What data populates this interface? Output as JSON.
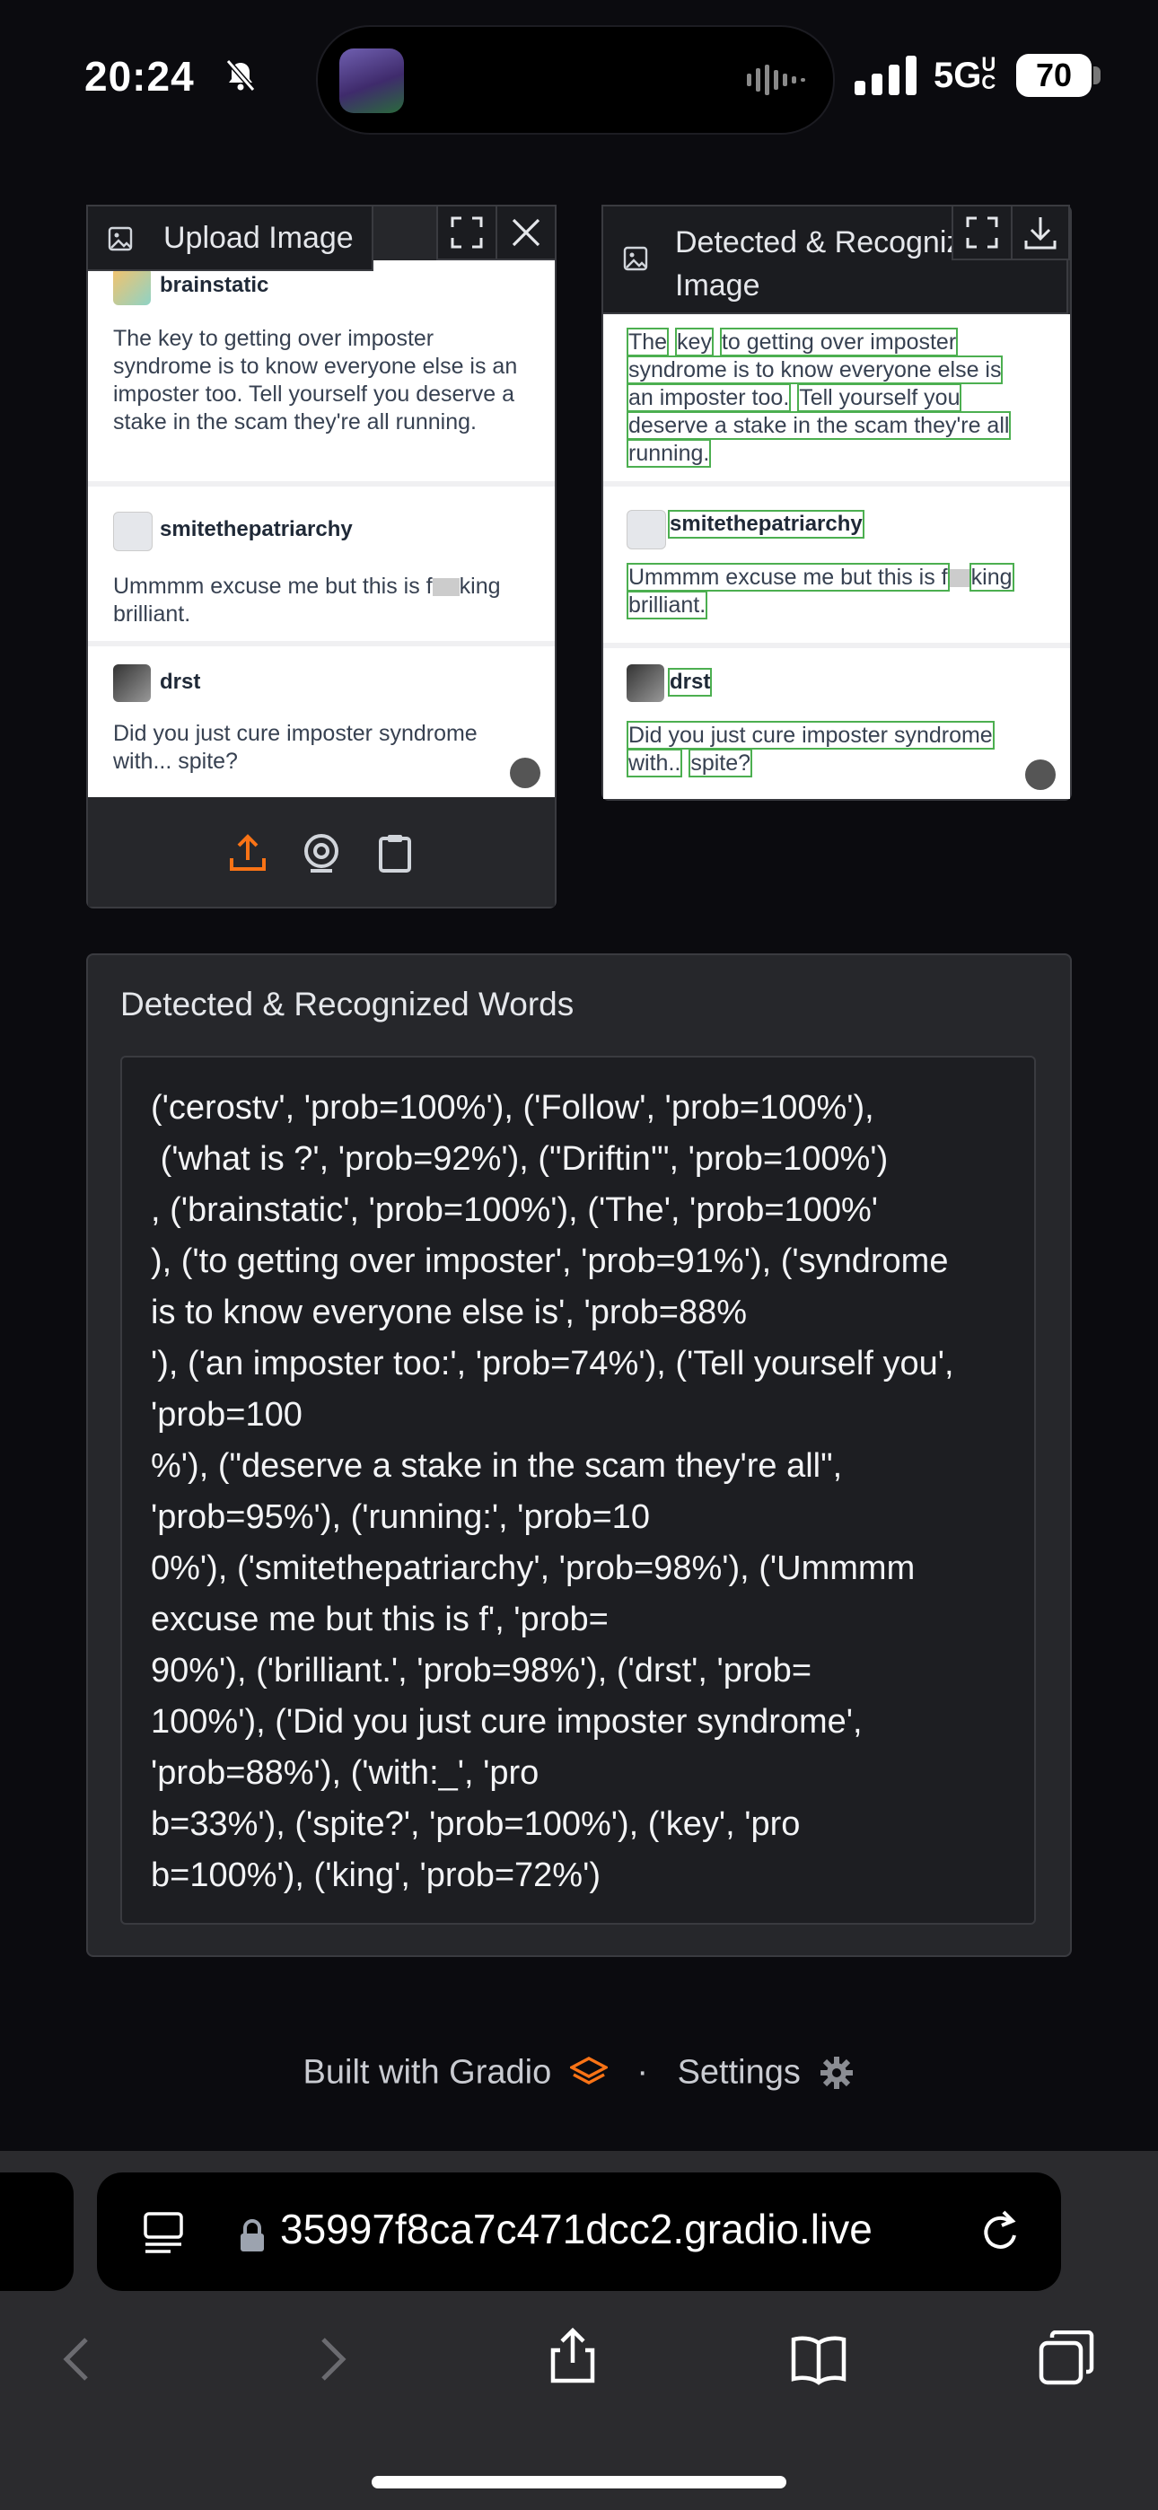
{
  "status_bar": {
    "time": "20:24",
    "network": "5G",
    "network_suffix": "UC",
    "battery": "70"
  },
  "upload_panel": {
    "label": "Upload Image"
  },
  "detected_panel": {
    "label_line1": "Detected & Recognize",
    "label_line2": "Image"
  },
  "post": {
    "user1": "brainstatic",
    "text1": "The key to getting over imposter syndrome is to know everyone else is an imposter too. Tell yourself you deserve a stake in the scam they're all running.",
    "user2": "smitethepatriarchy",
    "text2_a": "Ummmm excuse me but this is f",
    "text2_b": "king",
    "text2_c": "brilliant.",
    "user3": "drst",
    "text3": "Did you just cure imposter syndrome with... spite?"
  },
  "post_detected": {
    "l1_w1": "The",
    "l1_w2": "key",
    "l1_rest": "to getting over imposter",
    "l2": "syndrome is to know everyone else is",
    "l3_a": "an imposter too.",
    "l3_b": "Tell yourself you",
    "l4": "deserve a stake in the scam they're all",
    "l5": "running.",
    "user2": "smitethepatriarchy",
    "l6_a": "Ummmm excuse me but this is f",
    "l6_b": "king",
    "l7": "brilliant.",
    "user3": "drst",
    "l8": "Did you just cure imposter syndrome",
    "l9_a": "with..",
    "l9_b": "spite?"
  },
  "words": {
    "title": "Detected & Recognized Words",
    "text": "('cerostv', 'prob=100%'), ('Follow', 'prob=100%'),\n ('what is ?', 'prob=92%'), (\"Driftin'\", 'prob=100%')\n, ('brainstatic', 'prob=100%'), ('The', 'prob=100%'\n), ('to getting over imposter', 'prob=91%'), ('syndrome\nis to know everyone else is', 'prob=88%\n'), ('an imposter too:', 'prob=74%'), ('Tell yourself you',\n'prob=100\n%'), (\"deserve a stake in the scam they're all\",\n'prob=95%'), ('running:', 'prob=10\n0%'), ('smitethepatriarchy', 'prob=98%'), ('Ummmm\nexcuse me but this is f', 'prob=\n90%'), ('brilliant.', 'prob=98%'), ('drst', 'prob=\n100%'), ('Did you just cure imposter syndrome',\n'prob=88%'), ('with:_', 'pro\nb=33%'), ('spite?', 'prob=100%'), ('key', 'pro\nb=100%'), ('king', 'prob=72%')"
  },
  "footer": {
    "built_with": "Built with Gradio",
    "separator": "·",
    "settings": "Settings"
  },
  "browser": {
    "url": "35997f8ca7c471dcc2.gradio.live"
  },
  "colors": {
    "accent": "#f97316",
    "detection_box": "#4caf50"
  }
}
